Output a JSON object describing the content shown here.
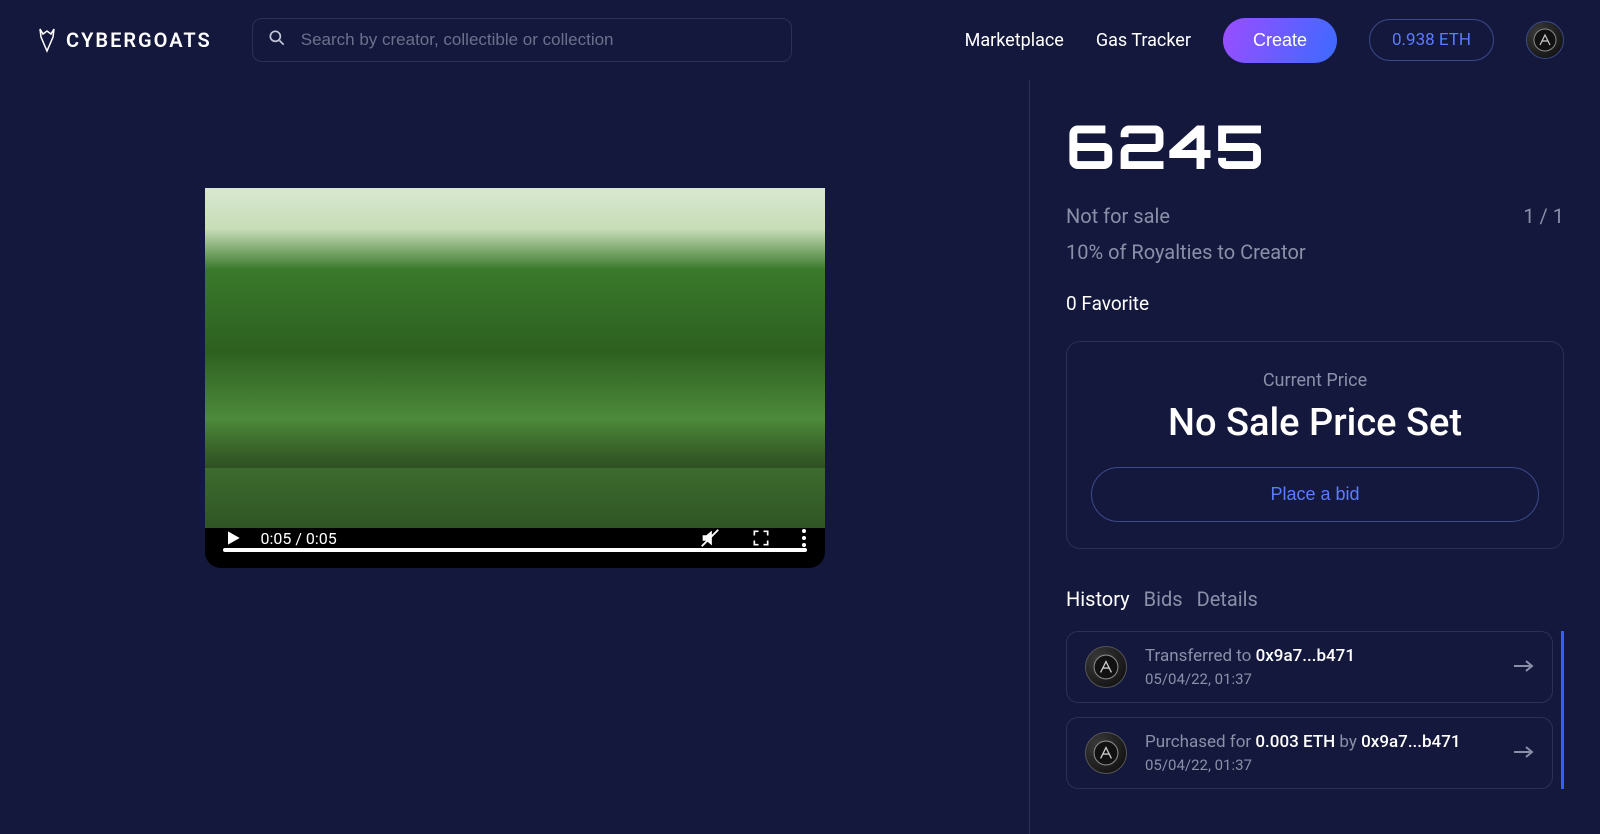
{
  "header": {
    "brand": "CYBERGOATS",
    "search_placeholder": "Search by creator, collectible or collection",
    "nav": {
      "marketplace": "Marketplace",
      "gas_tracker": "Gas Tracker"
    },
    "create_label": "Create",
    "balance": "0.938 ETH"
  },
  "video": {
    "time": "0:05 / 0:05"
  },
  "item": {
    "title": "6245",
    "sale_status": "Not for sale",
    "edition": "1 / 1",
    "royalty": "10% of Royalties to Creator",
    "favorite": "0 Favorite",
    "price_label": "Current Price",
    "price_value": "No Sale Price Set",
    "bid_label": "Place a bid"
  },
  "tabs": {
    "history": "History",
    "bids": "Bids",
    "details": "Details"
  },
  "history": [
    {
      "prefix": "Transferred to ",
      "strong1": "0x9a7...b471",
      "mid": "",
      "strong2": "",
      "time": "05/04/22, 01:37"
    },
    {
      "prefix": "Purchased for ",
      "strong1": "0.003 ETH",
      "mid": " by ",
      "strong2": "0x9a7...b471",
      "time": "05/04/22, 01:37"
    }
  ]
}
